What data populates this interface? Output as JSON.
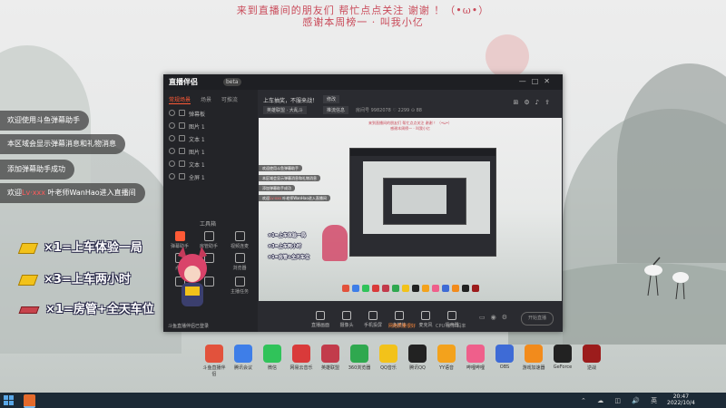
{
  "banner": {
    "line1": "来到直播间的朋友们 帮忙点点关注 谢谢 ！（•ω•）",
    "line2": "感谢本周榜一 · 叫我小亿"
  },
  "chat": [
    {
      "text": "欢迎使用斗鱼弹幕助手"
    },
    {
      "text": "本区域会显示弹幕消息和礼物消息"
    },
    {
      "text": "添加弹幕助手成功"
    },
    {
      "prefix": "欢迎",
      "user": "Lv·xxx",
      "text": " 叶老师WanHao进入直播间"
    }
  ],
  "gifts": [
    {
      "icon": "gold-bar-icon",
      "text": "×1=上车体验一局"
    },
    {
      "icon": "gold-bar-icon",
      "text": "×3=上车两小时"
    },
    {
      "icon": "plane-icon",
      "text": "×1=房管+全天车位"
    }
  ],
  "app": {
    "logo": "直播伴侣",
    "version": "beta",
    "window_controls": [
      "—",
      "□",
      "✕"
    ],
    "sidebar_tabs": [
      "常规场景",
      "场景",
      "可推流"
    ],
    "layers": [
      "弹幕板",
      "图片 1",
      "文本 1",
      "图片 1",
      "文本 1",
      "全屏 1"
    ],
    "tools_title": "工具箱",
    "tools": [
      {
        "label": "弹幕助手",
        "icon": "danmu-icon"
      },
      {
        "label": "房管助手",
        "icon": "admin-icon"
      },
      {
        "label": "视频连麦",
        "icon": "video-icon"
      },
      {
        "label": "点歌",
        "icon": "music-icon"
      },
      {
        "label": "",
        "icon": "tool-icon"
      },
      {
        "label": "浏览器",
        "icon": "browser-icon"
      },
      {
        "label": "",
        "icon": "tool-icon"
      },
      {
        "label": "",
        "icon": "tool-icon"
      },
      {
        "label": "主播任务",
        "icon": "task-icon"
      }
    ],
    "stream_title": "上车抽奖，不服来战！",
    "edit_label": "修改",
    "category": "英雄联盟 · 大乱斗",
    "category_btn": "推流信息",
    "meta": "房间号 9982078   ♡ 2299   ⊙ 88",
    "controls": [
      {
        "label": "直播画面",
        "icon": "screen-icon"
      },
      {
        "label": "摄像头",
        "icon": "camera-icon"
      },
      {
        "label": "手机投屏",
        "icon": "phone-icon"
      },
      {
        "label": "多媒体",
        "icon": "media-icon"
      },
      {
        "label": "麦克风",
        "icon": "mic-icon"
      },
      {
        "label": "扬声器",
        "icon": "speaker-icon"
      }
    ],
    "start_label": "开始直播",
    "status_left": "斗鱼直播伴侣已登录",
    "status_right": "网络质量很好",
    "status_mid": "CPU  帧率  码率"
  },
  "desktop_icons": [
    {
      "label": "斗鱼直播伴侣",
      "color": "#e2523c"
    },
    {
      "label": "腾讯会议",
      "color": "#3e7ee8"
    },
    {
      "label": "微信",
      "color": "#30c35a"
    },
    {
      "label": "网易云音乐",
      "color": "#d93a3a"
    },
    {
      "label": "英雄联盟",
      "color": "#c23b4b"
    },
    {
      "label": "360浏览器",
      "color": "#2fa84f"
    },
    {
      "label": "QQ音乐",
      "color": "#f2c21a"
    },
    {
      "label": "腾讯QQ",
      "color": "#222222"
    },
    {
      "label": "YY语音",
      "color": "#f3a21c"
    },
    {
      "label": "哔哩哔哩",
      "color": "#ef5f8b"
    },
    {
      "label": "OBS",
      "color": "#3e6bd6"
    },
    {
      "label": "游戏加速器",
      "color": "#f28b1c"
    },
    {
      "label": "GeForce",
      "color": "#222222"
    },
    {
      "label": "逆战",
      "color": "#9c1c1c"
    }
  ],
  "taskbar": {
    "time": "20:47",
    "date": "2022/10/4",
    "tray": "⌃ ☁ ◫ 🔊 英"
  }
}
